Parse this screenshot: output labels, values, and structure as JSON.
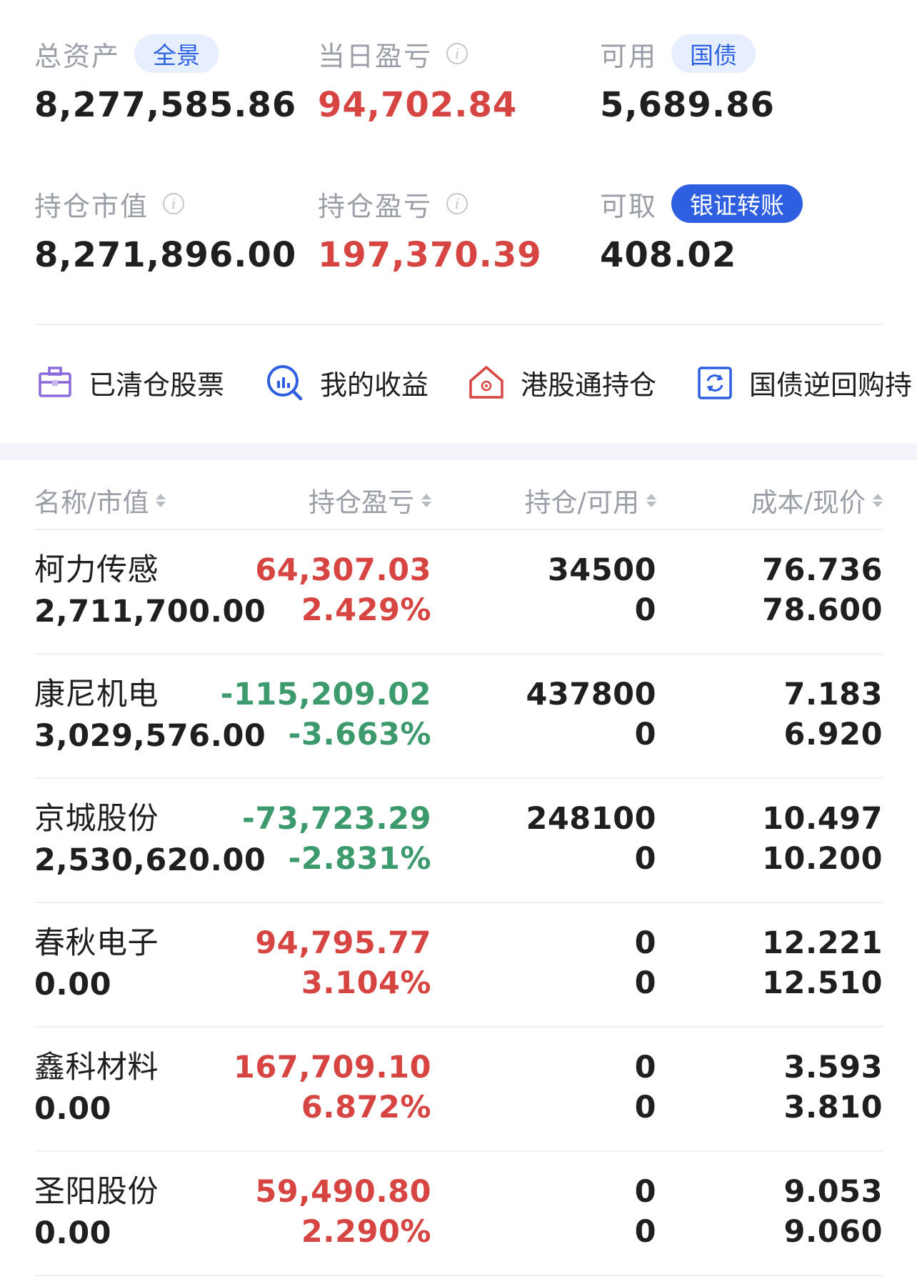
{
  "summary": {
    "total_assets": {
      "label": "总资产",
      "tag": "全景",
      "value": "8,277,585.86"
    },
    "daily_pnl": {
      "label": "当日盈亏",
      "value": "94,702.84"
    },
    "available": {
      "label": "可用",
      "tag": "国债",
      "value": "5,689.86"
    },
    "position_value": {
      "label": "持仓市值",
      "value": "8,271,896.00"
    },
    "position_pnl": {
      "label": "持仓盈亏",
      "value": "197,370.39"
    },
    "withdrawable": {
      "label": "可取",
      "tag": "银证转账",
      "value": "408.02"
    }
  },
  "shortcuts": [
    {
      "label": "已清仓股票",
      "icon": "briefcase-icon"
    },
    {
      "label": "我的收益",
      "icon": "chart-search-icon"
    },
    {
      "label": "港股通持仓",
      "icon": "hk-house-icon"
    },
    {
      "label": "国债逆回购持",
      "icon": "repo-cycle-icon"
    }
  ],
  "table": {
    "headers": [
      "名称/市值",
      "持仓盈亏",
      "持仓/可用",
      "成本/现价"
    ],
    "rows": [
      {
        "name": "柯力传感",
        "market_value": "2,711,700.00",
        "pnl": "64,307.03",
        "pnl_pct": "2.429%",
        "holding": "34500",
        "available": "0",
        "cost": "76.736",
        "price": "78.600",
        "trend": "up"
      },
      {
        "name": "康尼机电",
        "market_value": "3,029,576.00",
        "pnl": "-115,209.02",
        "pnl_pct": "-3.663%",
        "holding": "437800",
        "available": "0",
        "cost": "7.183",
        "price": "6.920",
        "trend": "down"
      },
      {
        "name": "京城股份",
        "market_value": "2,530,620.00",
        "pnl": "-73,723.29",
        "pnl_pct": "-2.831%",
        "holding": "248100",
        "available": "0",
        "cost": "10.497",
        "price": "10.200",
        "trend": "down"
      },
      {
        "name": "春秋电子",
        "market_value": "0.00",
        "pnl": "94,795.77",
        "pnl_pct": "3.104%",
        "holding": "0",
        "available": "0",
        "cost": "12.221",
        "price": "12.510",
        "trend": "up"
      },
      {
        "name": "鑫科材料",
        "market_value": "0.00",
        "pnl": "167,709.10",
        "pnl_pct": "6.872%",
        "holding": "0",
        "available": "0",
        "cost": "3.593",
        "price": "3.810",
        "trend": "up"
      },
      {
        "name": "圣阳股份",
        "market_value": "0.00",
        "pnl": "59,490.80",
        "pnl_pct": "2.290%",
        "holding": "0",
        "available": "0",
        "cost": "9.053",
        "price": "9.060",
        "trend": "up"
      }
    ]
  },
  "colors": {
    "up": "#d64541",
    "down": "#3c9a6c",
    "accent": "#2d5fe0",
    "muted": "#9a9ea6"
  }
}
